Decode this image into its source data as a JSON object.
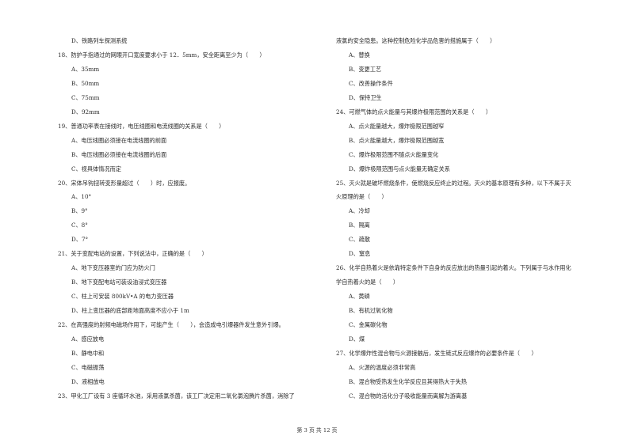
{
  "page": {
    "footer": "第 3 页 共 12 页"
  },
  "left_column": [
    {
      "type": "option",
      "text": "D、铁路列车探测系统"
    },
    {
      "type": "question",
      "text": "18、防护手指通过的网眼开口宽度要求小于 12．5mm，安全距离至少为（　　）"
    },
    {
      "type": "option",
      "text": "A、35mm"
    },
    {
      "type": "option",
      "text": "B、50mm"
    },
    {
      "type": "option",
      "text": "C、75mm"
    },
    {
      "type": "option",
      "text": "D、92mm"
    },
    {
      "type": "question",
      "text": "19、普通功率表在接线时，电压线圈和电流线圈的关系是（　　）"
    },
    {
      "type": "option",
      "text": "A、电压线圈必须接在电流线圈的前面"
    },
    {
      "type": "option",
      "text": "B、电压线圈必须接在电流线圈的后面"
    },
    {
      "type": "option",
      "text": "C、视具体情况而定"
    },
    {
      "type": "question",
      "text": "20、宋体吊钩扭转变形量超过（　　）时，应报废。"
    },
    {
      "type": "option",
      "text": "A、10°"
    },
    {
      "type": "option",
      "text": "B、9°"
    },
    {
      "type": "option",
      "text": "C、8°"
    },
    {
      "type": "option",
      "text": "D、7°"
    },
    {
      "type": "question",
      "text": "21、关于变配电站的设置，下列说法中，正确的是（　　）"
    },
    {
      "type": "option",
      "text": "A、地下变压器室的门应为防火门"
    },
    {
      "type": "option",
      "text": "B、地下变配电站可装设油浸式变压器"
    },
    {
      "type": "option",
      "text": "C、柱上可安装 800kV•A 的电力变压器"
    },
    {
      "type": "option",
      "text": "D、柱上变压器的底部距地面高度不应小于 1m"
    },
    {
      "type": "question",
      "text": "22、在高强度的射频电磁场作用下，可能产生（　　），会造成电引爆器件发生意外引爆。"
    },
    {
      "type": "option",
      "text": "A、感应放电"
    },
    {
      "type": "option",
      "text": "B、静电中和"
    },
    {
      "type": "option",
      "text": "C、电磁振荡"
    },
    {
      "type": "option",
      "text": "D、液相放电"
    },
    {
      "type": "question",
      "text": "23、甲化工厂设有 3 座循环水池，采用液氯杀菌，该工厂决定用二氧化氯泡腾片杀菌，消除了"
    }
  ],
  "right_column": [
    {
      "type": "continuation",
      "text": "液氯的安全隐患。这种控制危险化学品危害的措施属于（　　）"
    },
    {
      "type": "option",
      "text": "A、替换"
    },
    {
      "type": "option",
      "text": "B、变更工艺"
    },
    {
      "type": "option",
      "text": "C、改善操作条件"
    },
    {
      "type": "option",
      "text": "D、保持卫生"
    },
    {
      "type": "question",
      "text": "24、可燃气体的点火能量与其爆炸极限范围的关系是（　　）"
    },
    {
      "type": "option",
      "text": "A、点火能量越大，爆炸极限范围越窄"
    },
    {
      "type": "option",
      "text": "B、点火能量越大，爆炸极限范围越宽"
    },
    {
      "type": "option",
      "text": "C、爆炸极限范围不随点火能量变化"
    },
    {
      "type": "option",
      "text": "D、爆炸极限范围与点火能量无确定关系"
    },
    {
      "type": "question",
      "text": "25、灭火就是破坏燃烧条件，使燃烧反应终止的过程。灭火的基本原理有多种，以下不属于灭"
    },
    {
      "type": "continuation",
      "text": "火原理的是（　　）"
    },
    {
      "type": "option",
      "text": "A、冷却"
    },
    {
      "type": "option",
      "text": "B、隔离"
    },
    {
      "type": "option",
      "text": "C、疏散"
    },
    {
      "type": "option",
      "text": "D、窒息"
    },
    {
      "type": "question",
      "text": "26、化学自热着火是依靠特定条件下自身的反应放出的热量引起的着火。下列属于与水作用化"
    },
    {
      "type": "continuation",
      "text": "学自热着火的是（　　）"
    },
    {
      "type": "option",
      "text": "A、黄磷"
    },
    {
      "type": "option",
      "text": "B、有机过氧化物"
    },
    {
      "type": "option",
      "text": "C、金属碳化物"
    },
    {
      "type": "option",
      "text": "D、煤"
    },
    {
      "type": "question",
      "text": "27、化学爆炸性混合物与火源接触后，发生链式反应爆炸的必要条件是（　　）"
    },
    {
      "type": "option",
      "text": "A、火源的温度必须非常高"
    },
    {
      "type": "option",
      "text": "B、混合物受热发生化学反应且其得热大于失热"
    },
    {
      "type": "option",
      "text": "C、混合物的活化分子吸收能量而离解为游离基"
    }
  ]
}
